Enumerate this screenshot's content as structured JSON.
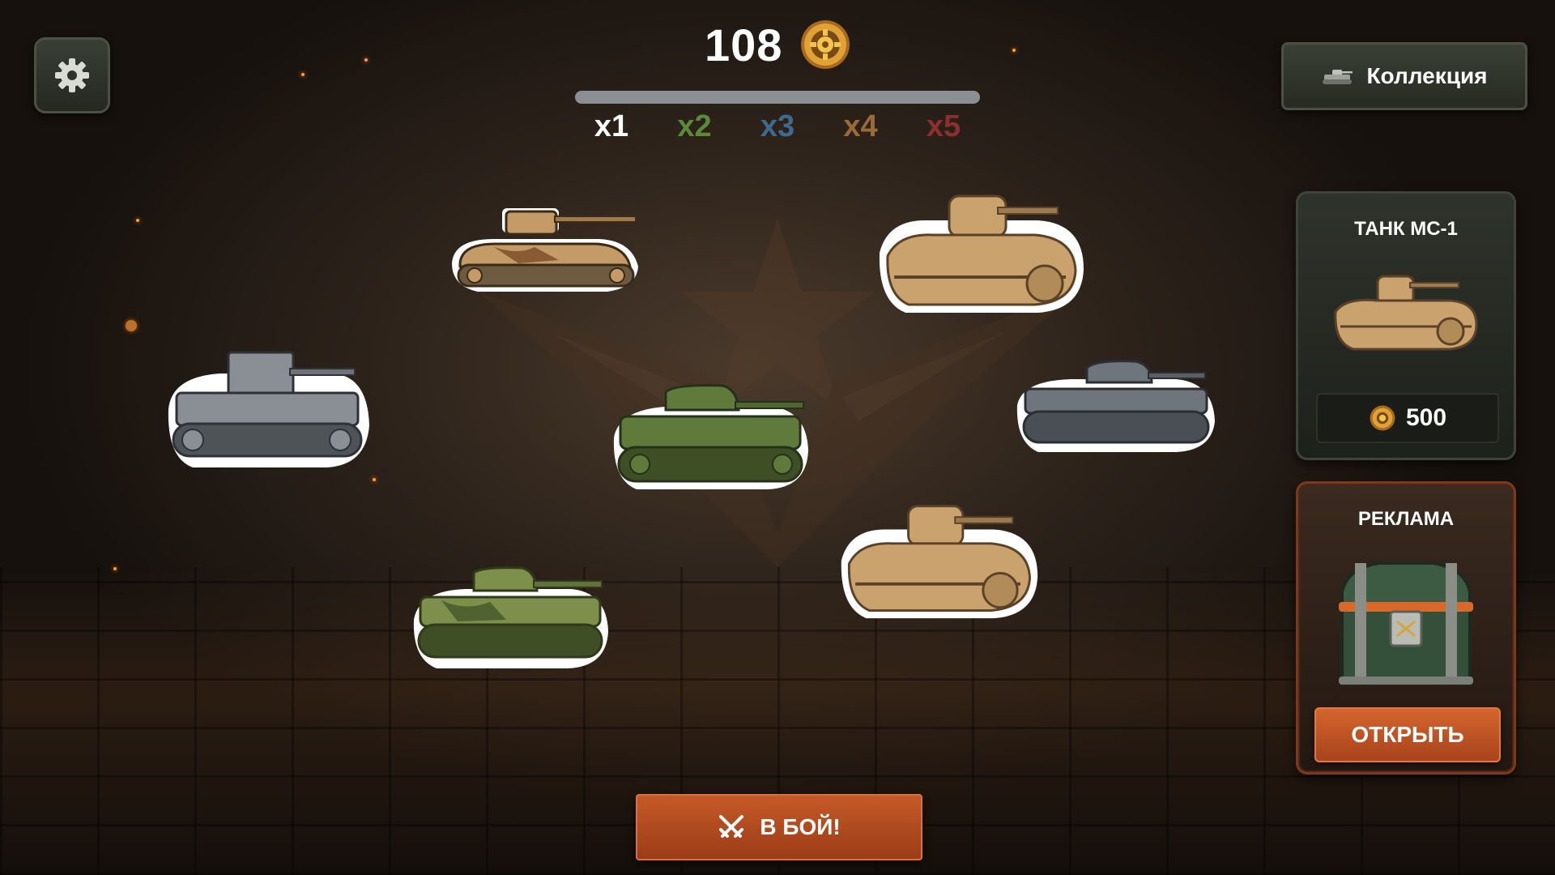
{
  "score": {
    "value": "108",
    "icon": "gear-coin-icon"
  },
  "progress": {
    "fraction": 1.0
  },
  "multipliers": [
    {
      "label": "x1",
      "color": "#ffffff"
    },
    {
      "label": "x2",
      "color": "#5a8a3a"
    },
    {
      "label": "x3",
      "color": "#3e6a8e"
    },
    {
      "label": "x4",
      "color": "#9a6a3a"
    },
    {
      "label": "x5",
      "color": "#8e2f2f"
    }
  ],
  "collection": {
    "label": "Коллекция",
    "icon": "tank-icon"
  },
  "tank_offer": {
    "title": "ТАНК МС-1",
    "price": "500",
    "icon": "gear-coin-icon"
  },
  "ad_offer": {
    "title": "РЕКЛАМА",
    "button_label": "ОТКРЫТЬ",
    "icon": "chest-icon"
  },
  "battle": {
    "label": "В БОЙ!",
    "icon": "crossed-swords-icon"
  },
  "tanks": [
    {
      "id": "tank-desert-camo",
      "color": "#c49a66",
      "camo": "#8a5a33"
    },
    {
      "id": "tank-mc1-upper",
      "color": "#c9a26d",
      "camo": ""
    },
    {
      "id": "tank-grey-t26",
      "color": "#8a8f95",
      "camo": ""
    },
    {
      "id": "tank-green-kv",
      "color": "#5f7a3a",
      "camo": ""
    },
    {
      "id": "tank-grey-heavy",
      "color": "#6f757c",
      "camo": ""
    },
    {
      "id": "tank-mc1-lower",
      "color": "#c9a26d",
      "camo": ""
    },
    {
      "id": "tank-green-camo",
      "color": "#7d8f4a",
      "camo": "#4f6230"
    }
  ]
}
